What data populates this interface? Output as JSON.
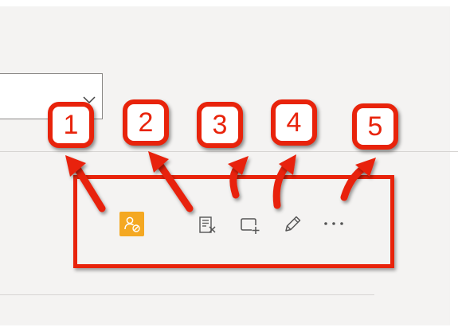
{
  "annotation": {
    "color": "#e8230b",
    "badges": [
      {
        "label": "1"
      },
      {
        "label": "2"
      },
      {
        "label": "3"
      },
      {
        "label": "4"
      },
      {
        "label": "5"
      }
    ]
  },
  "toolbar": {
    "icons": [
      {
        "name": "presence-blocked-icon",
        "color": "#f4a822"
      },
      {
        "name": "clear-history-icon"
      },
      {
        "name": "new-window-icon"
      },
      {
        "name": "edit-icon"
      },
      {
        "name": "more-options-icon"
      }
    ]
  },
  "dropdown": {
    "icon": "chevron-down-icon"
  }
}
